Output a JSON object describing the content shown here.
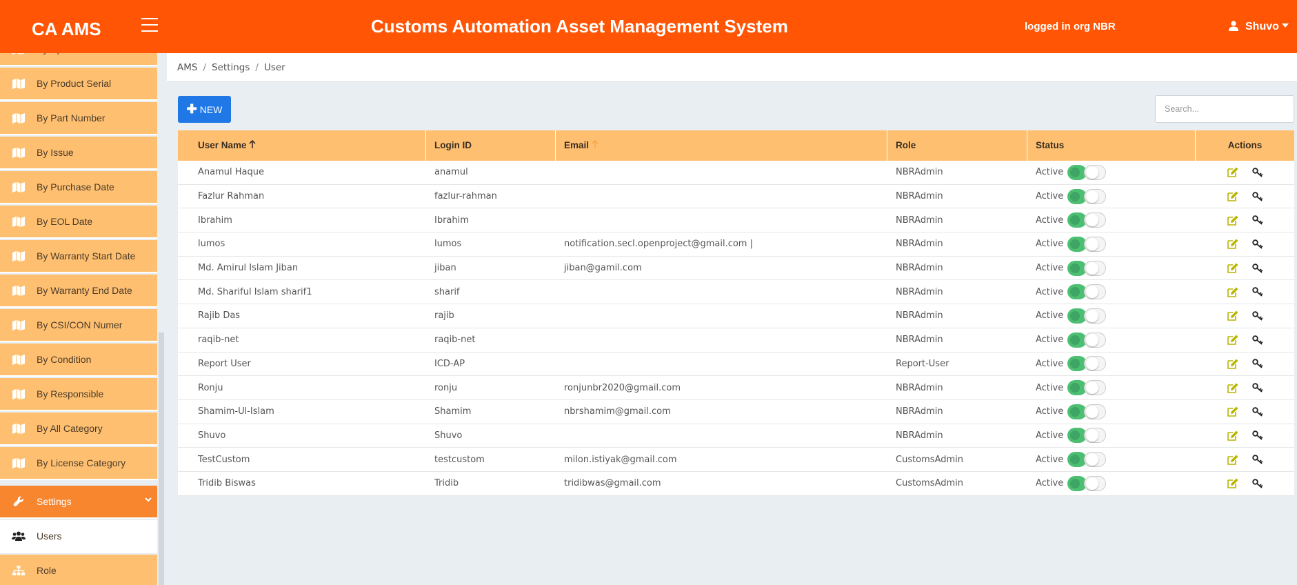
{
  "header": {
    "brand": "CA AMS",
    "title": "Customs Automation Asset Management System",
    "org_info": "logged in org NBR",
    "user": "Shuvo"
  },
  "sidebar": {
    "items": [
      {
        "label": "By Specification",
        "icon": "map-icon"
      },
      {
        "label": "By Product Serial",
        "icon": "map-icon"
      },
      {
        "label": "By Part Number",
        "icon": "map-icon"
      },
      {
        "label": "By Issue",
        "icon": "map-icon"
      },
      {
        "label": "By Purchase Date",
        "icon": "map-icon"
      },
      {
        "label": "By EOL Date",
        "icon": "map-icon"
      },
      {
        "label": "By Warranty Start Date",
        "icon": "map-icon"
      },
      {
        "label": "By Warranty End Date",
        "icon": "map-icon"
      },
      {
        "label": "By CSI/CON Numer",
        "icon": "map-icon"
      },
      {
        "label": "By Condition",
        "icon": "map-icon"
      },
      {
        "label": "By Responsible",
        "icon": "map-icon"
      },
      {
        "label": "By All Category",
        "icon": "map-icon"
      },
      {
        "label": "By License Category",
        "icon": "map-icon"
      }
    ],
    "settings": {
      "label": "Settings",
      "icon": "wrench-icon"
    },
    "users": {
      "label": "Users",
      "icon": "users-icon"
    },
    "role": {
      "label": "Role",
      "icon": "sitemap-icon"
    }
  },
  "breadcrumb": [
    "AMS",
    "Settings",
    "User"
  ],
  "toolbar": {
    "new_label": "NEW",
    "search_placeholder": "Search..."
  },
  "table": {
    "headers": {
      "username": "User Name",
      "login": "Login ID",
      "email": "Email",
      "role": "Role",
      "status": "Status",
      "actions": "Actions"
    },
    "rows": [
      {
        "name": "Anamul Haque",
        "login": "anamul",
        "email": "",
        "role": "NBRAdmin",
        "status": "Active"
      },
      {
        "name": "Fazlur Rahman",
        "login": "fazlur-rahman",
        "email": "",
        "role": "NBRAdmin",
        "status": "Active"
      },
      {
        "name": "Ibrahim",
        "login": "Ibrahim",
        "email": "",
        "role": "NBRAdmin",
        "status": "Active"
      },
      {
        "name": "lumos",
        "login": "lumos",
        "email": "notification.secl.openproject@gmail.com |",
        "role": "NBRAdmin",
        "status": "Active"
      },
      {
        "name": "Md. Amirul Islam Jiban",
        "login": "jiban",
        "email": "jiban@gamil.com",
        "role": "NBRAdmin",
        "status": "Active"
      },
      {
        "name": "Md. Shariful Islam sharif1",
        "login": "sharif",
        "email": "",
        "role": "NBRAdmin",
        "status": "Active"
      },
      {
        "name": "Rajib Das",
        "login": "rajib",
        "email": "",
        "role": "NBRAdmin",
        "status": "Active"
      },
      {
        "name": "raqib-net",
        "login": "raqib-net",
        "email": "",
        "role": "NBRAdmin",
        "status": "Active"
      },
      {
        "name": "Report User",
        "login": "ICD-AP",
        "email": "",
        "role": "Report-User",
        "status": "Active"
      },
      {
        "name": "Ronju",
        "login": "ronju",
        "email": "ronjunbr2020@gmail.com",
        "role": "NBRAdmin",
        "status": "Active"
      },
      {
        "name": "Shamim-Ul-Islam",
        "login": "Shamim",
        "email": "nbrshamim@gmail.com",
        "role": "NBRAdmin",
        "status": "Active"
      },
      {
        "name": "Shuvo",
        "login": "Shuvo",
        "email": "",
        "role": "NBRAdmin",
        "status": "Active"
      },
      {
        "name": "TestCustom",
        "login": "testcustom",
        "email": "milon.istiyak@gmail.com",
        "role": "CustomsAdmin",
        "status": "Active"
      },
      {
        "name": "Tridib Biswas",
        "login": "Tridib",
        "email": "tridibwas@gmail.com",
        "role": "CustomsAdmin",
        "status": "Active"
      }
    ]
  },
  "colors": {
    "navbar": "#ff5504",
    "sidebar_item": "#fec070",
    "active_item": "#f7862f",
    "primary_button": "#1f78e6",
    "toggle_on": "#4cbf73",
    "edit_icon": "#b8b400"
  }
}
